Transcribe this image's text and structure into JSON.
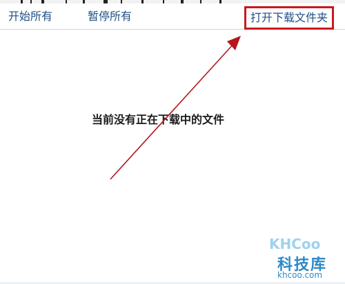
{
  "toolbar": {
    "start_all": "开始所有",
    "pause_all": "暂停所有",
    "open_download_folder": "打开下载文件夹"
  },
  "main": {
    "empty_message": "当前没有正在下载中的文件"
  },
  "annotation": {
    "highlight_color": "#c8181e",
    "arrow_color": "#b5161c"
  },
  "watermark": {
    "brand": "KHCoo",
    "chinese": "科技库",
    "url": "khcoo.com"
  }
}
